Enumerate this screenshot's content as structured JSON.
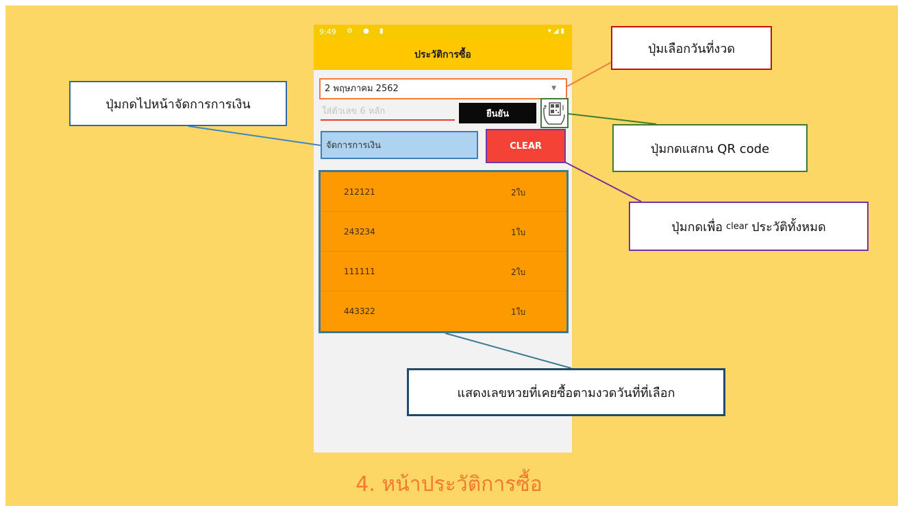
{
  "status_bar": {
    "time": "9:49",
    "left_icons": "⚙ ● ▮",
    "right_icons": "▾◢▮"
  },
  "app_bar": {
    "title": "ประวัติการซื้อ"
  },
  "date_select": {
    "value": "2 พฤษภาคม 2562"
  },
  "number_input": {
    "placeholder": "ใส่ตัวเลข 6 หลัก"
  },
  "buttons": {
    "confirm_label": "ยืนยัน",
    "money_label": "จัดการการเงิน",
    "clear_label": "CLEAR"
  },
  "history": [
    {
      "number": "212121",
      "count": "2ใบ"
    },
    {
      "number": "243234",
      "count": "1ใบ"
    },
    {
      "number": "111111",
      "count": "2ใบ"
    },
    {
      "number": "443322",
      "count": "1ใบ"
    }
  ],
  "callouts": {
    "date": "ปุ่มเลือกวันที่งวด",
    "money": "ปุ่มกดไปหน้าจัดการการเงิน",
    "qr": "ปุ่มกดแสกน QR code",
    "clear_prefix": "ปุ่มกดเพื่อ",
    "clear_word": "clear",
    "clear_suffix": "ประวัติทั้งหมด",
    "list": "แสดงเลขหวยที่เคยซื้อตามงวดวันที่ที่เลือก"
  },
  "caption": "4. หน้าประวัติการซื้อ",
  "colors": {
    "background": "#fdd766",
    "app_bar": "#fec700",
    "list": "#fd9a01",
    "clear_button": "#f44336",
    "money_button": "#aed3f1",
    "caption": "#f07b2e"
  }
}
